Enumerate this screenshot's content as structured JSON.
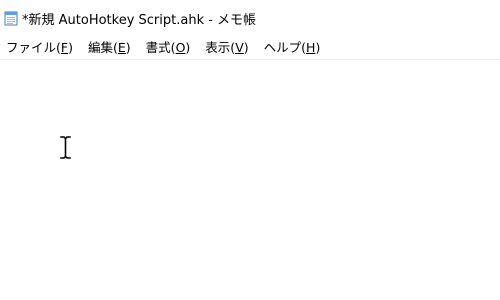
{
  "window": {
    "title": "*新規 AutoHotkey Script.ahk - メモ帳",
    "icon": "notepad-icon"
  },
  "menu": {
    "items": [
      {
        "label": "ファイル(",
        "key": "F",
        "close": ")"
      },
      {
        "label": "編集(",
        "key": "E",
        "close": ")"
      },
      {
        "label": "書式(",
        "key": "O",
        "close": ")"
      },
      {
        "label": "表示(",
        "key": "V",
        "close": ")"
      },
      {
        "label": "ヘルプ(",
        "key": "H",
        "close": ")"
      }
    ]
  },
  "editor": {
    "content": "",
    "cursor": "ibeam-cursor-icon"
  },
  "colors": {
    "background": "#ffffff",
    "text": "#000000",
    "icon_blue": "#4a90d9"
  }
}
